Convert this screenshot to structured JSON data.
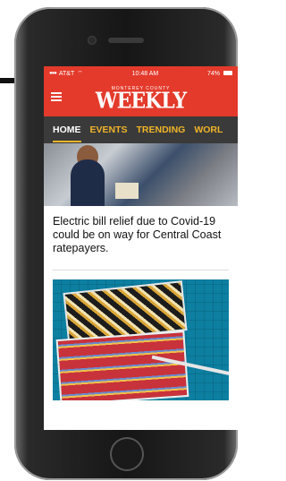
{
  "status_bar": {
    "carrier": "AT&T",
    "time": "10:48 AM",
    "battery": "74%"
  },
  "app_bar": {
    "logo_small": "MONTEREY COUNTY",
    "logo_big": "WEEKLY"
  },
  "nav": {
    "tabs": [
      {
        "label": "HOME"
      },
      {
        "label": "EVENTS"
      },
      {
        "label": "TRENDING"
      },
      {
        "label": "WORL"
      }
    ]
  },
  "articles": [
    {
      "headline": "Electric bill relief due to Covid-19 could be on way for Central Coast ratepayers."
    }
  ],
  "colors": {
    "brand_red": "#e33a2b",
    "nav_bg": "#3a3a3a",
    "nav_accent": "#f0b429"
  }
}
